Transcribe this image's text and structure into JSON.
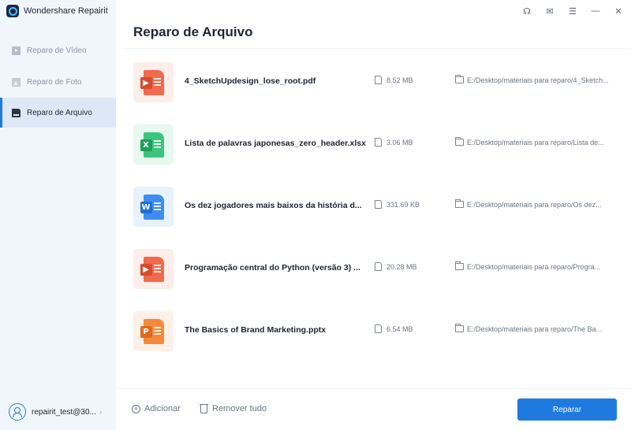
{
  "app": {
    "title": "Wondershare Repairit",
    "logo": "repairit-logo"
  },
  "window_controls": [
    {
      "name": "support-icon",
      "glyph": "☊"
    },
    {
      "name": "mail-icon",
      "glyph": "✉"
    },
    {
      "name": "menu-icon",
      "glyph": "☰"
    },
    {
      "name": "minimize-icon",
      "glyph": "—"
    },
    {
      "name": "close-icon",
      "glyph": "✕"
    }
  ],
  "sidebar": {
    "items": [
      {
        "label": "Reparo de Vídeo",
        "icon": "video-icon",
        "active": false
      },
      {
        "label": "Reparo de Foto",
        "icon": "photo-icon",
        "active": false
      },
      {
        "label": "Reparo de Arquivo",
        "icon": "file-icon",
        "active": true
      }
    ],
    "user": {
      "name": "repairit_test@30...",
      "chevron": "›"
    }
  },
  "main": {
    "title": "Reparo de Arquivo",
    "files": [
      {
        "type": "pdf",
        "badge": "▶",
        "name": "4_SketchUpdesign_lose_root.pdf",
        "size": "8.52 MB",
        "path": "E:/Desktop/materiais para reparo/4_Sketch..."
      },
      {
        "type": "xlsx",
        "badge": "X",
        "name": "Lista de palavras japonesas_zero_header.xlsx",
        "size": "3.06 MB",
        "path": "E:/Desktop/materiais para reparo/Lista de..."
      },
      {
        "type": "docx",
        "badge": "W",
        "name": "Os dez jogadores mais baixos da história d...",
        "size": "331.69 KB",
        "path": "E:/Desktop/materiais para reparo/Os dez..."
      },
      {
        "type": "pdf",
        "badge": "▶",
        "name": "Programação central do Python (versão 3) ...",
        "size": "20.28 MB",
        "path": "E:/Desktop/materiais para reparo/Progra..."
      },
      {
        "type": "pptx",
        "badge": "P",
        "name": "The Basics of Brand Marketing.pptx",
        "size": "6.54 MB",
        "path": "E:/Desktop/materiais para reparo/The Ba..."
      }
    ]
  },
  "footer": {
    "add_label": "Adicionar",
    "add_glyph": "+",
    "remove_all_label": "Remover tudo",
    "repair_label": "Reparar"
  },
  "colors": {
    "accent": "#1f7ae0",
    "pdf_bg": "#fdeeea",
    "pdf_doc": "#f06a4d",
    "xlsx_bg": "#e7f8ee",
    "xlsx_doc": "#3cc47c",
    "docx_bg": "#e8f2fd",
    "docx_doc": "#3d8ef0",
    "pptx_bg": "#fdf0e6",
    "pptx_doc": "#f58a3c"
  }
}
